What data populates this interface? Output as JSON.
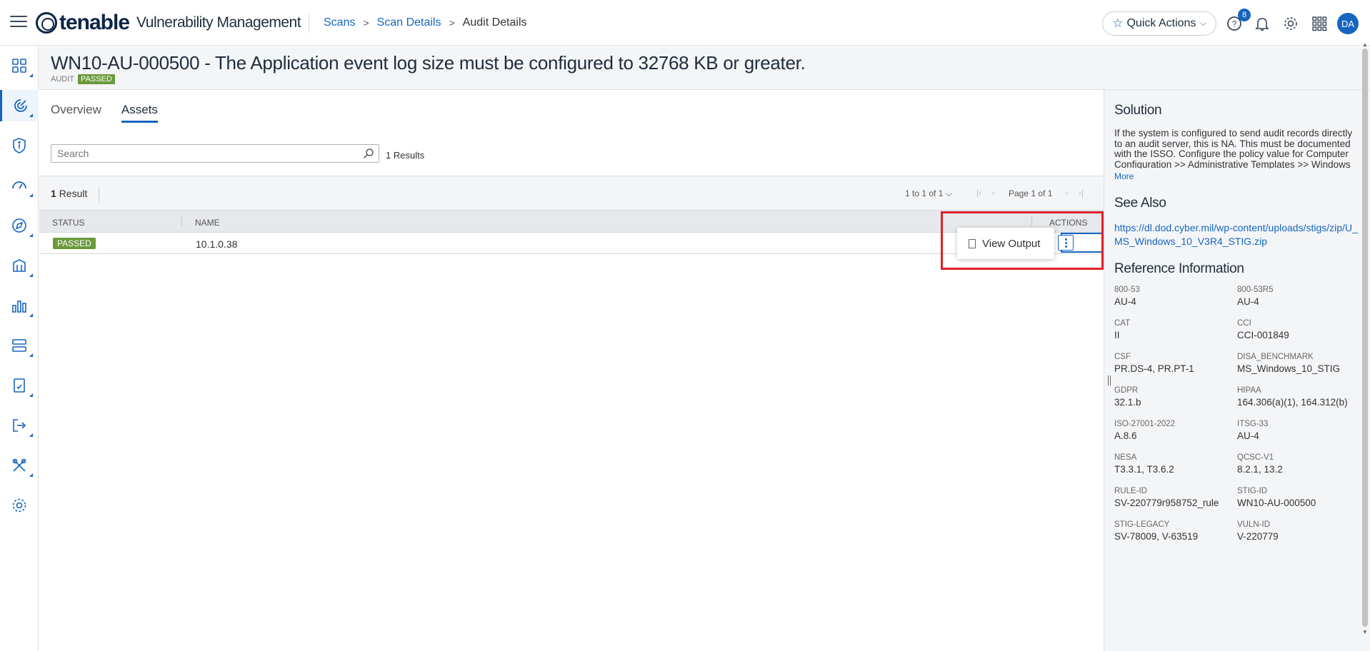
{
  "app": {
    "brand": "tenable",
    "product": "Vulnerability Management"
  },
  "breadcrumb": {
    "items": [
      "Scans",
      "Scan Details"
    ],
    "current": "Audit Details",
    "separator": ">"
  },
  "topbar": {
    "quick_actions": "Quick Actions",
    "help_badge": "8",
    "avatar": "DA"
  },
  "header": {
    "title": "WN10-AU-000500 - The Application event log size must be configured to 32768 KB or greater.",
    "type": "AUDIT",
    "status": "PASSED"
  },
  "tabs": [
    "Overview",
    "Assets"
  ],
  "search": {
    "placeholder": "Search",
    "results": "1 Results"
  },
  "table": {
    "result_count": "1",
    "result_label": "Result",
    "range": "1 to 1 of 1",
    "page": "Page 1 of 1",
    "columns": [
      "STATUS",
      "NAME",
      "ACTIONS"
    ],
    "rows": [
      {
        "status": "PASSED",
        "name": "10.1.0.38"
      }
    ]
  },
  "dropdown": {
    "view_output": "View Output"
  },
  "right_panel": {
    "solution_title": "Solution",
    "solution_text": "If the system is configured to send audit records directly to an audit server, this is NA. This must be documented with the ISSO. Configure the policy value for Computer Configuration >> Administrative Templates >> Windows Components >> Event Log Service >> Application >> Specify the maximum log file size (KB)",
    "more": "More",
    "see_also_title": "See Also",
    "see_also_link": "https://dl.dod.cyber.mil/wp-content/uploads/stigs/zip/U_MS_Windows_10_V3R4_STIG.zip",
    "reference_title": "Reference Information",
    "references": [
      {
        "label": "800-53",
        "value": "AU-4"
      },
      {
        "label": "800-53R5",
        "value": "AU-4"
      },
      {
        "label": "CAT",
        "value": "II"
      },
      {
        "label": "CCI",
        "value": "CCI-001849"
      },
      {
        "label": "CSF",
        "value": "PR.DS-4, PR.PT-1"
      },
      {
        "label": "DISA_BENCHMARK",
        "value": "MS_Windows_10_STIG"
      },
      {
        "label": "GDPR",
        "value": "32.1.b"
      },
      {
        "label": "HIPAA",
        "value": "164.306(a)(1), 164.312(b)"
      },
      {
        "label": "ISO-27001-2022",
        "value": "A.8.6"
      },
      {
        "label": "ITSG-33",
        "value": "AU-4"
      },
      {
        "label": "NESA",
        "value": "T3.3.1, T3.6.2"
      },
      {
        "label": "QCSC-V1",
        "value": "8.2.1, 13.2"
      },
      {
        "label": "RULE-ID",
        "value": "SV-220779r958752_rule"
      },
      {
        "label": "STIG-ID",
        "value": "WN10-AU-000500"
      },
      {
        "label": "STIG-LEGACY",
        "value": "SV-78009, V-63519"
      },
      {
        "label": "VULN-ID",
        "value": "V-220779"
      }
    ]
  },
  "colors": {
    "accent": "#1565c0",
    "passed": "#6b9a3b",
    "highlight": "#e0202a",
    "panel_bg": "#f4f5f7"
  },
  "icons": {
    "left_nav": [
      "dashboard-icon",
      "scans-icon",
      "findings-icon",
      "gauge-icon",
      "explore-icon",
      "assets-icon",
      "analytics-icon",
      "servers-icon",
      "reports-icon",
      "export-icon",
      "tools-icon",
      "settings-icon"
    ],
    "top": [
      "hamburger-icon",
      "help-icon",
      "bell-icon",
      "gear-icon",
      "apps-grid-icon"
    ]
  }
}
